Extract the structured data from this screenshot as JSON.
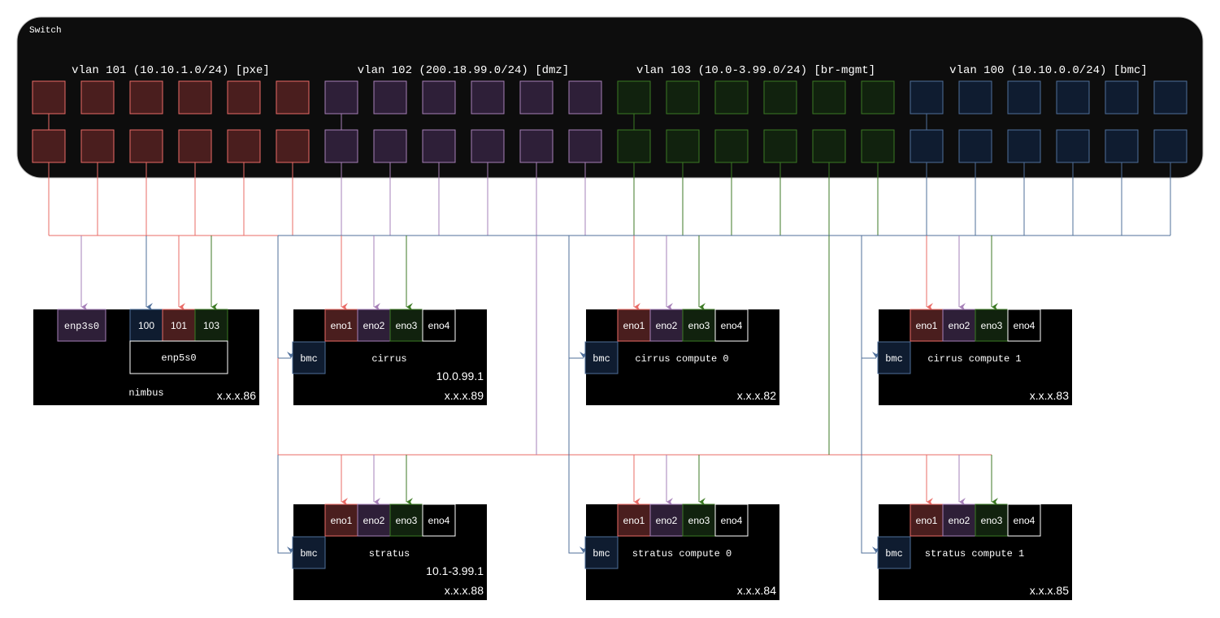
{
  "colors": {
    "background": "#ffffff",
    "switch_fill": "#0d0d0d",
    "host_fill": "#000000",
    "text": "#ffffff",
    "vlan101_stroke": "#ea6b66",
    "vlan101_fill": "#4a1e1e",
    "vlan102_stroke": "#a680b8",
    "vlan102_fill": "#2e1f38",
    "vlan103_stroke": "#3c7a24",
    "vlan103_fill": "#11220e",
    "vlan100_stroke": "#4f6f9a",
    "vlan100_fill": "#0f1c30",
    "white_stroke": "#ffffff"
  },
  "switch": {
    "title": "Switch",
    "vlans": [
      {
        "label": "vlan 101 (10.10.1.0/24) [pxe]",
        "key": "vlan101"
      },
      {
        "label": "vlan 102 (200.18.99.0/24) [dmz]",
        "key": "vlan102"
      },
      {
        "label": "vlan 103 (10.0-3.99.0/24) [br-mgmt]",
        "key": "vlan103"
      },
      {
        "label": "vlan 100 (10.10.0.0/24) [bmc]",
        "key": "vlan100"
      }
    ]
  },
  "nimbus": {
    "name": "nimbus",
    "ip": "x.x.x.86",
    "nic_single": "enp3s0",
    "nic_bond": "enp5s0",
    "vlan_tags": [
      "100",
      "101",
      "103"
    ]
  },
  "hosts": [
    {
      "name": "cirrus",
      "ip": "x.x.x.89",
      "extra_ip": "10.0.99.1",
      "bmc": "bmc",
      "nics": [
        "eno1",
        "eno2",
        "eno3",
        "eno4"
      ]
    },
    {
      "name": "cirrus compute 0",
      "ip": "x.x.x.82",
      "extra_ip": "",
      "bmc": "bmc",
      "nics": [
        "eno1",
        "eno2",
        "eno3",
        "eno4"
      ]
    },
    {
      "name": "cirrus compute 1",
      "ip": "x.x.x.83",
      "extra_ip": "",
      "bmc": "bmc",
      "nics": [
        "eno1",
        "eno2",
        "eno3",
        "eno4"
      ]
    },
    {
      "name": "stratus",
      "ip": "x.x.x.88",
      "extra_ip": "10.1-3.99.1",
      "bmc": "bmc",
      "nics": [
        "eno1",
        "eno2",
        "eno3",
        "eno4"
      ]
    },
    {
      "name": "stratus compute 0",
      "ip": "x.x.x.84",
      "extra_ip": "",
      "bmc": "bmc",
      "nics": [
        "eno1",
        "eno2",
        "eno3",
        "eno4"
      ]
    },
    {
      "name": "stratus compute 1",
      "ip": "x.x.x.85",
      "extra_ip": "",
      "bmc": "bmc",
      "nics": [
        "eno1",
        "eno2",
        "eno3",
        "eno4"
      ]
    }
  ]
}
